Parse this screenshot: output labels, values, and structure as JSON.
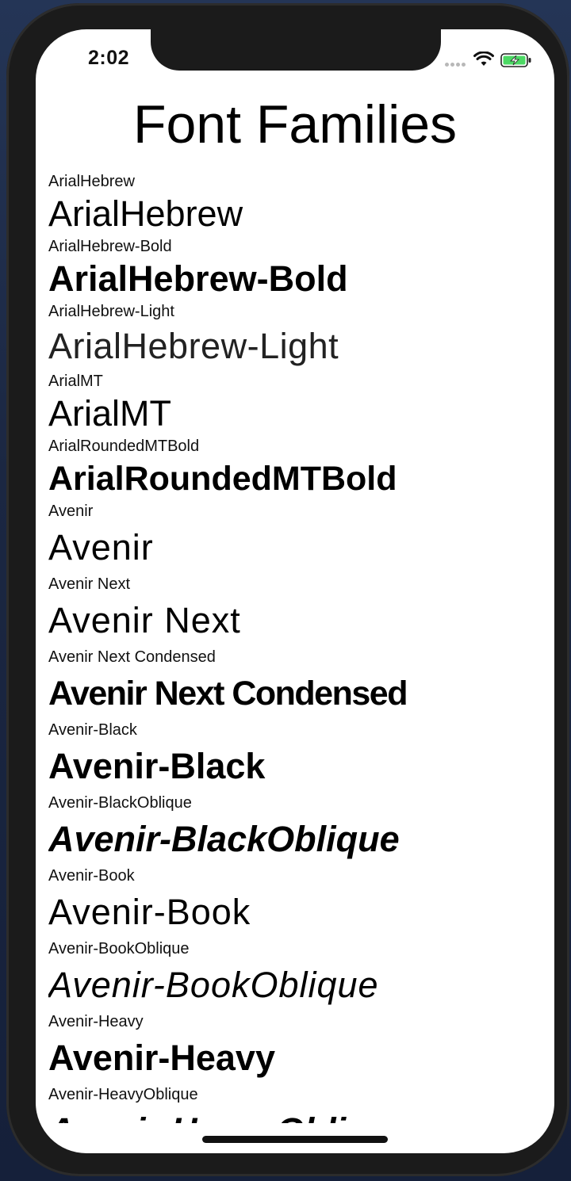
{
  "status_bar": {
    "time": "2:02",
    "wifi_icon": "wifi-icon",
    "battery_icon": "battery-charging-icon",
    "battery_color": "#4cd964"
  },
  "page": {
    "title": "Font Families"
  },
  "fonts": [
    {
      "label": "ArialHebrew",
      "sample": "ArialHebrew"
    },
    {
      "label": "ArialHebrew-Bold",
      "sample": "ArialHebrew-Bold"
    },
    {
      "label": "ArialHebrew-Light",
      "sample": "ArialHebrew-Light"
    },
    {
      "label": "ArialMT",
      "sample": "ArialMT"
    },
    {
      "label": "ArialRoundedMTBold",
      "sample": "ArialRoundedMTBold"
    },
    {
      "label": "Avenir",
      "sample": "Avenir"
    },
    {
      "label": "Avenir Next",
      "sample": "Avenir Next"
    },
    {
      "label": "Avenir Next Condensed",
      "sample": "Avenir Next Condensed"
    },
    {
      "label": "Avenir-Black",
      "sample": "Avenir-Black"
    },
    {
      "label": "Avenir-BlackOblique",
      "sample": "Avenir-BlackOblique"
    },
    {
      "label": "Avenir-Book",
      "sample": "Avenir-Book"
    },
    {
      "label": "Avenir-BookOblique",
      "sample": "Avenir-BookOblique"
    },
    {
      "label": "Avenir-Heavy",
      "sample": "Avenir-Heavy"
    },
    {
      "label": "Avenir-HeavyOblique",
      "sample": "Avenir-HeavyOblique"
    }
  ]
}
